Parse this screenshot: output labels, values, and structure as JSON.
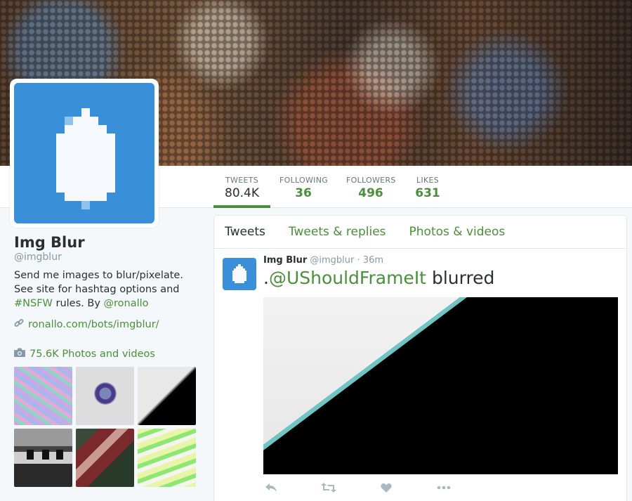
{
  "profile": {
    "name": "Img Blur",
    "handle": "@imgblur",
    "bio_text": "Send me images to blur/pixelate. See site for hashtag options and ",
    "bio_hashtag": "#NSFW",
    "bio_rules": " rules. By ",
    "bio_mention": "@ronallo",
    "url": "ronallo.com/bots/imgblur/",
    "photos_label": "75.6K Photos and videos"
  },
  "stats": [
    {
      "label": "TWEETS",
      "value": "80.4K"
    },
    {
      "label": "FOLLOWING",
      "value": "36"
    },
    {
      "label": "FOLLOWERS",
      "value": "496"
    },
    {
      "label": "LIKES",
      "value": "631"
    }
  ],
  "tabs": [
    "Tweets",
    "Tweets & replies",
    "Photos & videos"
  ],
  "tweet": {
    "author": "Img Blur",
    "handle": "@imgblur",
    "separator": "·",
    "time": "36m",
    "prefix": ".",
    "mention": "@UShouldFrameIt",
    "suffix": " blurred"
  },
  "colors": {
    "accent": "#4a8f3a",
    "avatar_bg": "#3a8fd9"
  },
  "icons": {
    "link": "link-icon",
    "camera": "camera-icon",
    "reply": "reply-icon",
    "retweet": "retweet-icon",
    "like": "heart-icon",
    "more": "more-icon"
  }
}
